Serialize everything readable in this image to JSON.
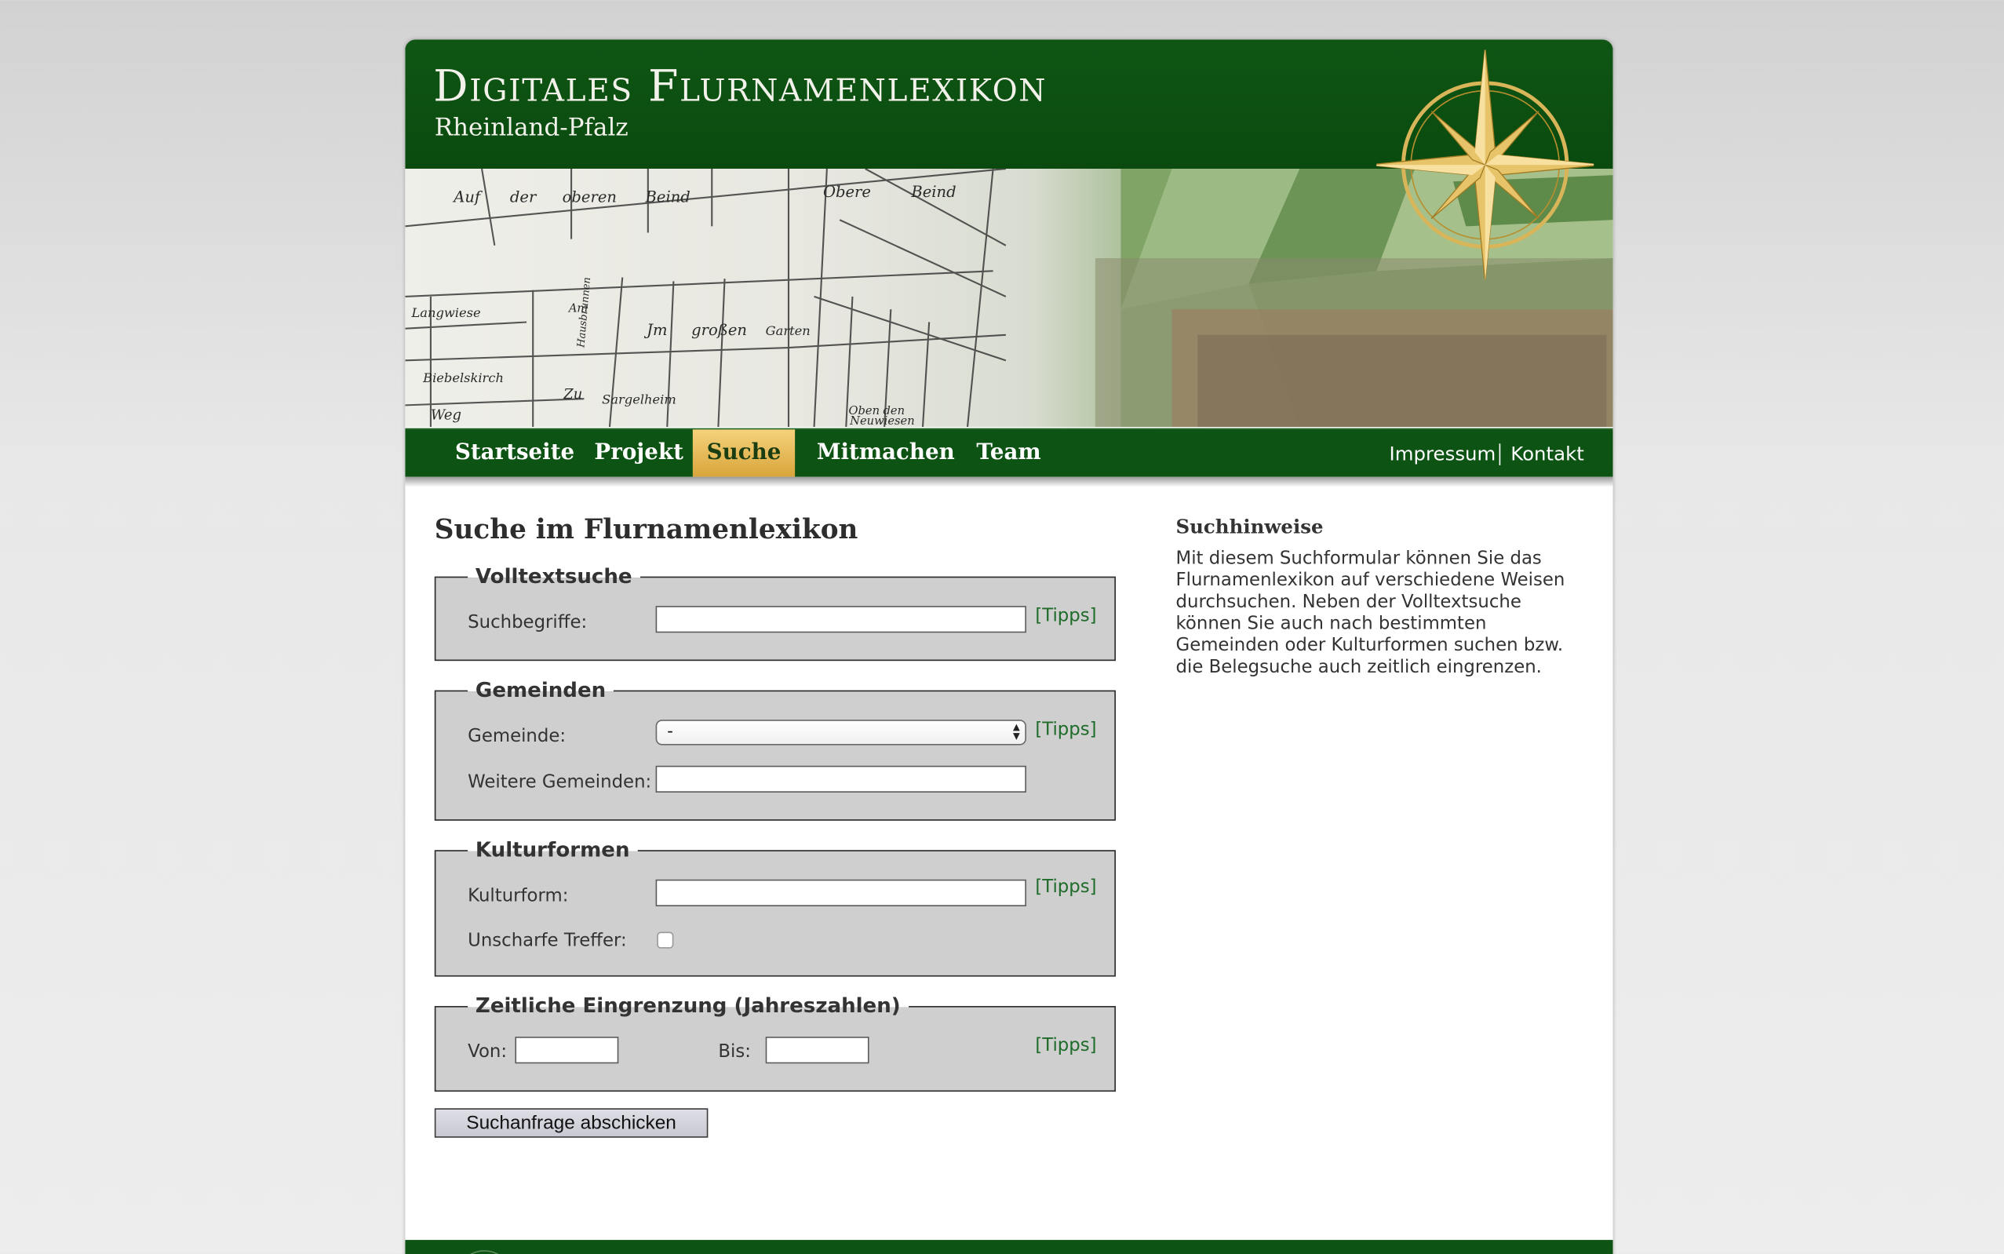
{
  "header": {
    "title": "Digitales Flurnamenlexikon",
    "subtitle": "Rheinland-Pfalz"
  },
  "banner": {
    "map_labels": [
      "Auf",
      "der",
      "oberen",
      "Beind",
      "Obere",
      "Beind",
      "Langwiese",
      "Am",
      "Hausbrunnen",
      "Jm",
      "großen",
      "Garten",
      "Biebelskirch",
      "Zu",
      "Sargelheim",
      "Weg",
      "Oben",
      "den",
      "Neuwiesen"
    ]
  },
  "nav": {
    "items": [
      "Startseite",
      "Projekt",
      "Suche",
      "Mitmachen",
      "Team"
    ],
    "active": "Suche",
    "right": [
      "Impressum",
      "Kontakt"
    ]
  },
  "main": {
    "title": "Suche im Flurnamenlexikon",
    "tipps_label": "[Tipps]",
    "volltext": {
      "legend": "Volltextsuche",
      "label": "Suchbegriffe:",
      "value": ""
    },
    "gemeinden": {
      "legend": "Gemeinden",
      "gemeinde_label": "Gemeinde:",
      "gemeinde_value": "-",
      "weitere_label": "Weitere Gemeinden:",
      "weitere_value": ""
    },
    "kulturformen": {
      "legend": "Kulturformen",
      "kulturform_label": "Kulturform:",
      "kulturform_value": "",
      "unscharf_label": "Unscharfe Treffer:",
      "unscharf_checked": false
    },
    "zeit": {
      "legend": "Zeitliche Eingrenzung (Jahreszahlen)",
      "von_label": "Von:",
      "von_value": "",
      "bis_label": "Bis:",
      "bis_value": ""
    },
    "submit_label": "Suchanfrage abschicken"
  },
  "sidebar": {
    "title": "Suchhinweise",
    "text": "Mit diesem Suchformular können Sie das Flurnamenlexikon auf verschiedene Weisen durchsuchen. Neben der Volltextsuche können Sie auch nach bestimmten Gemeinden oder Kulturformen suchen bzw. die Belegsuche auch zeitlich eingrenzen."
  },
  "colors": {
    "header_green": "#0f5614",
    "nav_active": "#e8b84f",
    "tipps_green": "#1e6b2a",
    "fieldset_bg": "#cfcfcf"
  }
}
